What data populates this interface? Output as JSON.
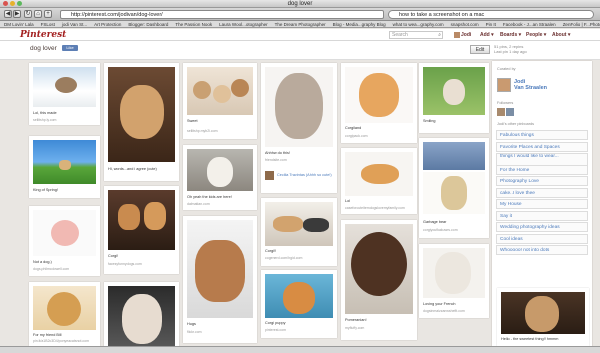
{
  "browser": {
    "window_title": "dog lover",
    "url": "http://pinterest.com/jodivan/dog-lover/",
    "search_text": "how to take a screenshot on a mac",
    "bookmarks": [
      "DM Lovin' Lala",
      "FSLost",
      "jodi Van St...",
      "Art Protection",
      "Blogger: Dashboard",
      "The Passion Nook",
      "Laura Wool...otographer",
      "The Dream Photographer",
      "Blog - Media...graphy Blog",
      "what to wea...graphy.com",
      "snapshot.com",
      "Pin It",
      "Facebook - J...an Straalen",
      "ZenFolio | F...Photography"
    ]
  },
  "pinterest": {
    "logo": "Pinterest",
    "search_placeholder": "Search",
    "nav": {
      "user": "Jodi",
      "add": "Add",
      "boards": "Boards",
      "people": "People",
      "about": "About"
    }
  },
  "board": {
    "name": "dog lover",
    "like_label": "Like",
    "edit_label": "Edit",
    "stats_line1": "51 pins, 2 repins",
    "stats_line2": "Last pin 1 day ago"
  },
  "pins": {
    "p1": {
      "caption": "Lol, this made",
      "source": "sellitshp.ly.com"
    },
    "p2": {
      "caption": "King of Spring!",
      "source": ""
    },
    "p3": {
      "caption": "Not a dog.)",
      "source": "dogs.philmcdowell.com"
    },
    "p4": {
      "caption": "For my friend Bill",
      "source": "pin.it/a1B2c3D4/ponyeacatsnot.com"
    },
    "p5": {
      "caption": "Hi, words...and i agree (cute)",
      "source": ""
    },
    "p6": {
      "caption": "Corgi!",
      "source": "facesyfunnydogs.com"
    },
    "p7": {
      "caption": "Sweet",
      "source": "sellitshp.myb2i.com"
    },
    "p8": {
      "caption": "Oh yeah the kids are here!",
      "source": "dalmatian.com"
    },
    "p9": {
      "caption": "Hugs",
      "source": "flickr.com"
    },
    "p10": {
      "caption": "Ahhhw do this!",
      "source": "friendsite.com",
      "repinner": "Cecilia Travintas (Ahhh so cute!)"
    },
    "p11": {
      "caption": "Corgi!!",
      "source": "cogenerd.com/hgid.com"
    },
    "p12": {
      "caption": "Corgi puppy",
      "source": "pinterest.com"
    },
    "p13": {
      "caption": "Corgiland",
      "source": "corgipack.com"
    },
    "p14": {
      "caption": "Lol",
      "source": "caseforcuteitemdogslovemyfamily.com"
    },
    "p15": {
      "caption": "Pomeranian!",
      "source": "myfluffy.com"
    },
    "p16": {
      "caption": "Smiling",
      "source": ""
    },
    "p17": {
      "caption": "Garbage bear",
      "source": "corgiyoufkakuwrs.com"
    },
    "p18": {
      "caption": "Loving your French",
      "source": "dogsinmaizzanwshefit.com"
    },
    "p19": {
      "caption": "Hello - the sweetest thing!! hmmm",
      "source": ""
    }
  },
  "sidebar": {
    "curated_label": "Curated by",
    "owner_first": "Jodi",
    "owner_last": "Van Straalen",
    "followers_label": "Followers",
    "other_boards_label": "Jodi's other pinboards",
    "boards": [
      "Fabulous things",
      "Favorite Places and Spaces",
      "things I would like to wear...",
      "For the Home",
      "Photography Love",
      "cake..I love thee",
      "My House",
      "Say it",
      "Wedding photography ideas",
      "Cool ideas",
      "Whooooo! not into dots"
    ]
  }
}
